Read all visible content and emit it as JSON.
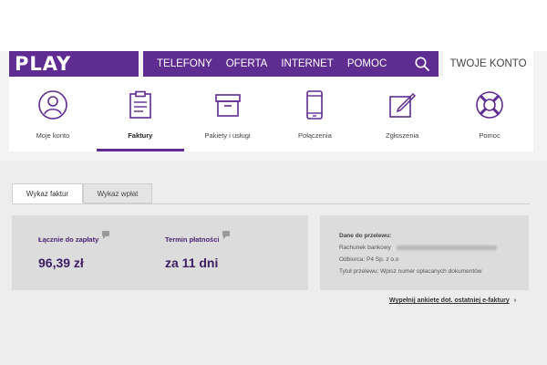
{
  "brand": {
    "logo_text": "PLAY",
    "color": "#5f2c91"
  },
  "nav": {
    "items": [
      "TELEFONY",
      "OFERTA",
      "INTERNET",
      "POMOC"
    ],
    "search_icon": "search-icon",
    "account": "TWOJE KONTO"
  },
  "sections": [
    {
      "label": "Moje konto",
      "icon": "user-icon",
      "active": false
    },
    {
      "label": "Faktury",
      "icon": "invoice-icon",
      "active": true
    },
    {
      "label": "Pakiety i usługi",
      "icon": "box-icon",
      "active": false
    },
    {
      "label": "Połączenia",
      "icon": "phone-icon",
      "active": false
    },
    {
      "label": "Zgłoszenia",
      "icon": "edit-icon",
      "active": false
    },
    {
      "label": "Pomoc",
      "icon": "lifebuoy-icon",
      "active": false
    }
  ],
  "tabs": {
    "invoices": "Wykaz faktur",
    "payments": "Wykaz wpłat"
  },
  "summary": {
    "total_label": "Łącznie do zapłaty",
    "total_value": "96,39 zł",
    "due_label": "Termin płatności",
    "due_value": "za 11 dni"
  },
  "transfer": {
    "title": "Dane do przelewu:",
    "account_label": "Rachunek bankowy",
    "recipient_label": "Odbiorca:",
    "recipient_value": "P4 Sp. z o.o",
    "title_label": "Tytuł przelewu:",
    "title_value": "Wpisz numer opłacanych dokumentów"
  },
  "survey_link": "Wypełnij ankietę dot. ostatniej e-faktury"
}
